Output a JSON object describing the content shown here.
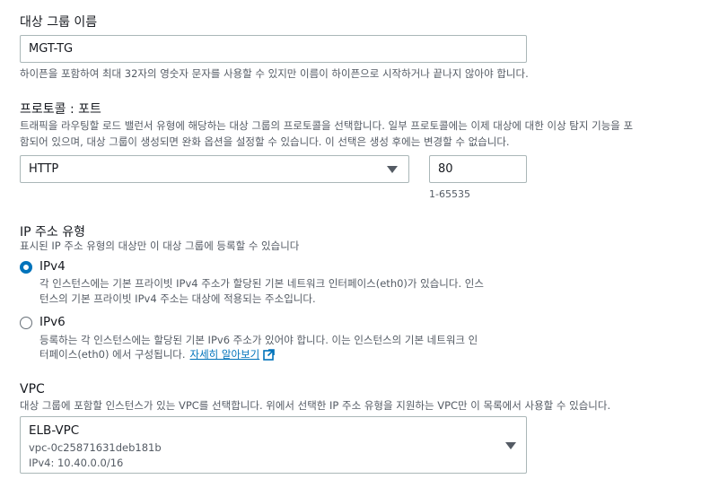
{
  "target_group_name": {
    "label": "대상 그룹 이름",
    "value": "MGT-TG",
    "hint": "하이픈을 포함하여 최대 32자의 영숫자 문자를 사용할 수 있지만 이름이 하이픈으로 시작하거나 끝나지 않아야 합니다."
  },
  "protocol_port": {
    "label": "프로토콜 : 포트",
    "desc_line1": "트래픽을 라우팅할 로드 밸런서 유형에 해당하는 대상 그룹의 프로토콜을 선택합니다. 일부 프로토콜에는 이제 대상에 대한 이상 탐지 기능을 포",
    "desc_line2": "함되어 있으며, 대상 그룹이 생성되면 완화 옵션을 설정할 수 있습니다. 이 선택은 생성 후에는 변경할 수 없습니다.",
    "protocol_value": "HTTP",
    "port_value": "80",
    "port_range": "1-65535"
  },
  "ip_address_type": {
    "label": "IP 주소 유형",
    "desc": "표시된 IP 주소 유형의 대상만 이 대상 그룹에 등록할 수 있습니다",
    "ipv4": {
      "title": "IPv4",
      "line1": "각 인스턴스에는 기본 프라이빗 IPv4 주소가 할당된 기본 네트워크 인터페이스(eth0)가 있습니다. 인스",
      "line2": "턴스의 기본 프라이빗 IPv4 주소는 대상에 적용되는 주소입니다.",
      "checked": true
    },
    "ipv6": {
      "title": "IPv6",
      "line1": "등록하는 각 인스턴스에는 할당된 기본 IPv6 주소가 있어야 합니다. 이는 인스턴스의 기본 네트워크 인",
      "line2": "터페이스(eth0) 에서 구성됩니다.",
      "link": "자세히 알아보기",
      "checked": false
    }
  },
  "vpc": {
    "label": "VPC",
    "desc": "대상 그룹에 포함할 인스턴스가 있는 VPC를 선택합니다. 위에서 선택한 IP 주소 유형을 지원하는 VPC만 이 목록에서 사용할 수 있습니다.",
    "name": "ELB-VPC",
    "id": "vpc-0c25871631deb181b",
    "cidr": "IPv4: 10.40.0.0/16"
  },
  "colors": {
    "accent": "#0073bb",
    "border": "#aab7b8",
    "muted_text": "#545b64"
  },
  "icons": [
    "external-link-icon",
    "caret-down-icon"
  ]
}
